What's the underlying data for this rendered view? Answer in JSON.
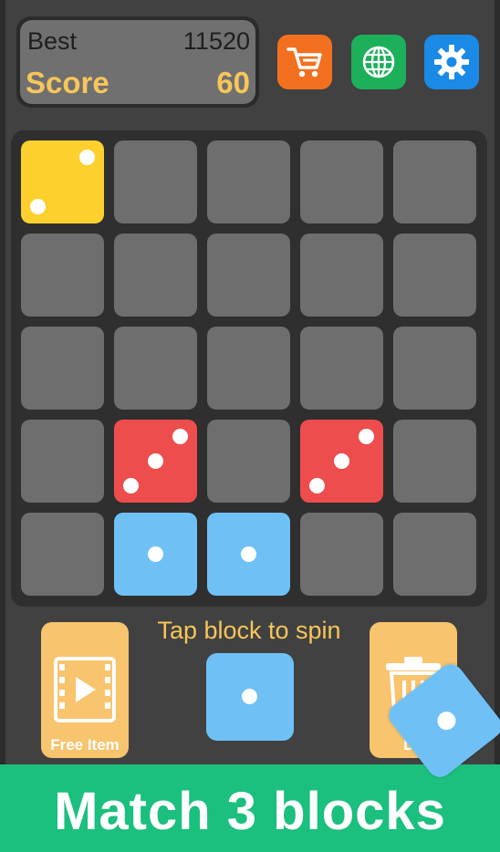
{
  "scoreboard": {
    "best_label": "Best",
    "best_value": "11520",
    "score_label": "Score",
    "score_value": "60"
  },
  "toolbar": {
    "shop_icon": "shopping-cart-icon",
    "language_icon": "globe-icon",
    "settings_icon": "gear-icon"
  },
  "board": {
    "rows": 5,
    "cols": 5,
    "dice": [
      {
        "row": 0,
        "col": 0,
        "color": "yellow",
        "value": 2
      },
      {
        "row": 3,
        "col": 1,
        "color": "red",
        "value": 3
      },
      {
        "row": 3,
        "col": 3,
        "color": "red",
        "value": 3
      },
      {
        "row": 4,
        "col": 1,
        "color": "blue",
        "value": 1
      },
      {
        "row": 4,
        "col": 2,
        "color": "blue",
        "value": 1
      }
    ]
  },
  "controls": {
    "hint": "Tap block to spin",
    "free_item_label": "Free Item",
    "delete_label": "De",
    "next_block": {
      "color": "blue",
      "value": 1
    }
  },
  "banner": {
    "text": "Match 3 blocks"
  },
  "colors": {
    "background": "#414141",
    "empty_cell": "#6e6e6e",
    "red": "#ee4d4d",
    "blue": "#6fc1f5",
    "yellow": "#fdd02e",
    "accent_text": "#f7c65a",
    "banner": "#1bbf7e"
  }
}
